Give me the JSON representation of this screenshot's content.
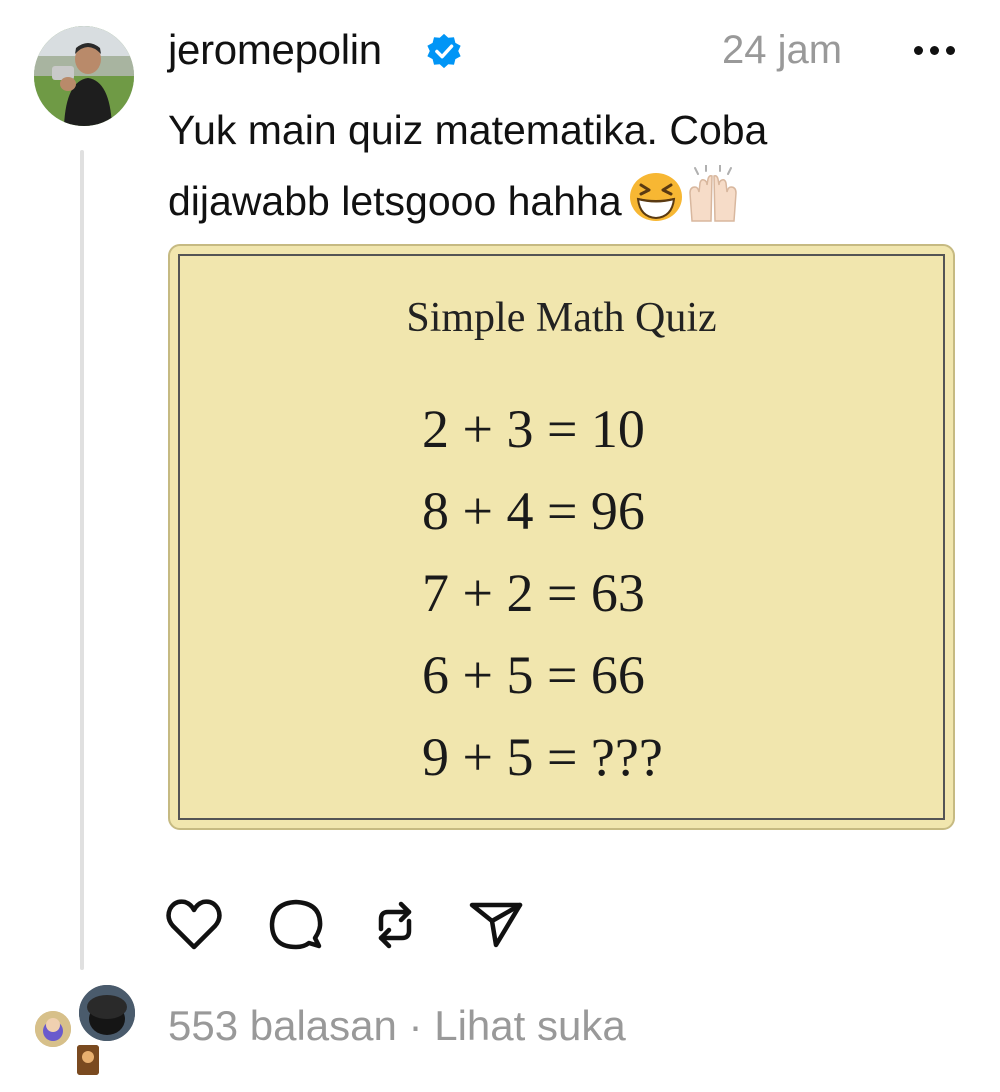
{
  "post": {
    "username": "jeromepolin",
    "timestamp": "24 jam",
    "caption_text": "Yuk main quiz matematika. Coba dijawabb letsgooo hahha",
    "caption_emojis": [
      "grinning-squinting-face-emoji",
      "raising-hands-emoji"
    ]
  },
  "image": {
    "title": "Simple Math Quiz",
    "equations": [
      "2 + 3 = 10",
      "8 + 4 = 96",
      "7 + 2 = 63",
      "6 + 5 = 66",
      "9 + 5 = ???"
    ],
    "background_color": "#f1e6ae"
  },
  "actions": {
    "icons": [
      "heart-icon",
      "comment-icon",
      "repost-icon",
      "share-icon"
    ]
  },
  "footer": {
    "replies": "553 balasan",
    "separator": "·",
    "likes_link": "Lihat suka"
  },
  "colors": {
    "verified": "#0095f6",
    "muted_text": "#999999",
    "primary_text": "#111111"
  }
}
